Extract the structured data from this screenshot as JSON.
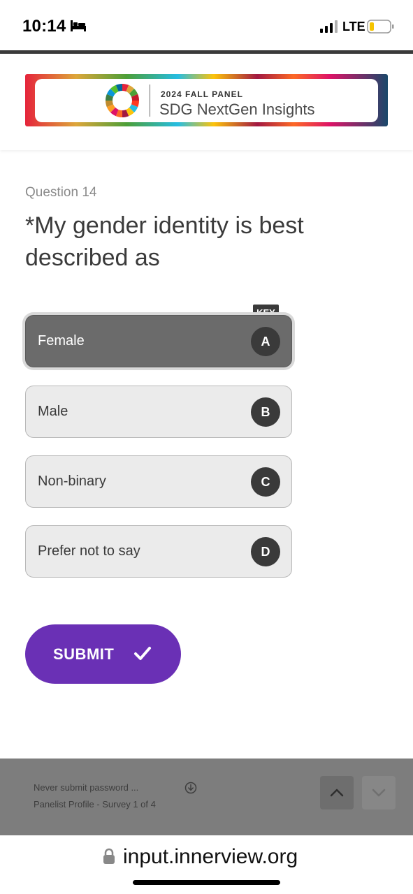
{
  "status_bar": {
    "time": "10:14",
    "network": "LTE"
  },
  "header": {
    "banner_kicker": "2024 FALL PANEL",
    "banner_title": "SDG NextGen Insights"
  },
  "question": {
    "number_label": "Question 14",
    "text": "*My gender identity is best described as",
    "key_badge": "KEY",
    "options": [
      {
        "label": "Female",
        "key": "A",
        "selected": true
      },
      {
        "label": "Male",
        "key": "B",
        "selected": false
      },
      {
        "label": "Non-binary",
        "key": "C",
        "selected": false
      },
      {
        "label": "Prefer not to say",
        "key": "D",
        "selected": false
      }
    ]
  },
  "submit": {
    "label": "SUBMIT",
    "color": "#6a30b5"
  },
  "bottom_bar": {
    "line1": "Never submit password   ...",
    "line2": "Panelist Profile - Survey 1 of 4"
  },
  "url_bar": {
    "url": "input.innerview.org"
  }
}
